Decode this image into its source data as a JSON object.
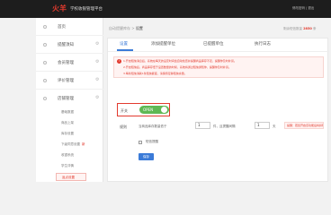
{
  "app": {
    "logo": "火羊",
    "system_name": "学校收银管理平台",
    "top_right": "修改密码 | 退出"
  },
  "sidebar": {
    "items": [
      {
        "label": "首页"
      },
      {
        "label": "提醒须知"
      },
      {
        "label": "会员管理"
      },
      {
        "label": "评价管理"
      },
      {
        "label": "店铺管理"
      }
    ],
    "sub_items": [
      {
        "label": "基础数据"
      },
      {
        "label": "商品上架"
      },
      {
        "label": "库存设置"
      },
      {
        "label": "下级同意设置",
        "badge": "新"
      },
      {
        "label": "收银系统"
      },
      {
        "label": "学生详情"
      },
      {
        "label": "返点设置"
      }
    ]
  },
  "main": {
    "breadcrumb_parent": "自动提醒库存",
    "breadcrumb_sep": ">",
    "breadcrumb_current": "设置",
    "balance_label": "剩余短信数量",
    "balance_value": "2850",
    "balance_unit": "条"
  },
  "tabs": [
    {
      "label": "设置",
      "active": true
    },
    {
      "label": "添加提醒单位"
    },
    {
      "label": "已提醒单位"
    },
    {
      "label": "执行日志"
    }
  ],
  "notice": {
    "lines": [
      "1.开启短信消息后，系统在每天的设定时间会自动检查并提醒商品库存不足，提醒你及时补货。",
      "2.开启短信后，商品库存低于设置数量的时候，系统将通过短信通知你，提醒你及时补货。",
      "3.每条短信消耗1条短信额度，请保持足够短信余量。"
    ]
  },
  "switch": {
    "label": "开关",
    "state_text": "OPEN"
  },
  "rule": {
    "label": "规则",
    "text1": "当商品库存数量低于",
    "value1": "1",
    "text2": "件，且提醒间隔",
    "value2": "1",
    "text3": "天",
    "warning": "提醒：若您开启该功能后将扣除短信"
  },
  "checkbox": {
    "label": "短信提醒"
  },
  "save_button": {
    "label": "保存"
  },
  "colors": {
    "accent_red": "#e23a2e",
    "accent_blue": "#3b7bd8",
    "toggle_green": "#5fb854"
  }
}
